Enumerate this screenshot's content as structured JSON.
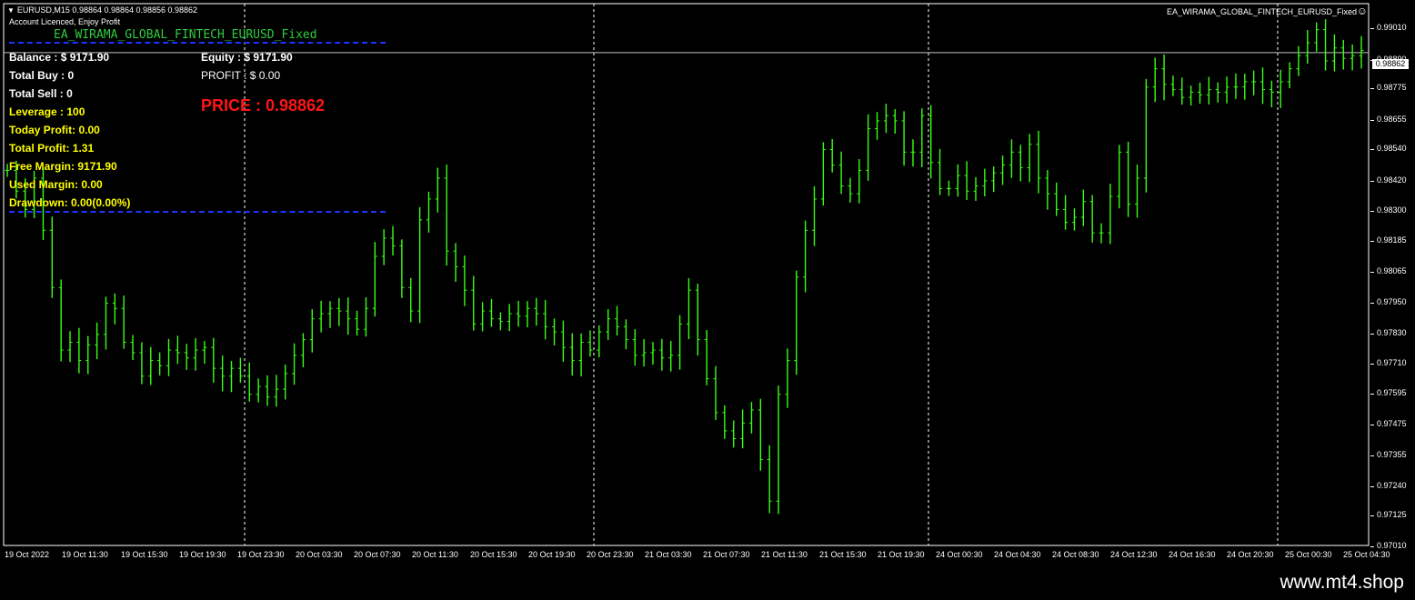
{
  "window": {
    "symbol_line": "EURUSD,M15  0.98864 0.98864 0.98856 0.98862",
    "licence_text": "Account Licenced, Enjoy Profit",
    "ea_name_top": "EA_WIRAMA_GLOBAL_FINTECH_EURUSD_Fixed",
    "smiley": "☺",
    "triangle": "▼"
  },
  "panel": {
    "ea_title": "EA_WIRAMA_GLOBAL_FINTECH_EURUSD_Fixed",
    "balance": "Balance : $ 9171.90",
    "equity": "Equity : $ 9171.90",
    "total_buy": "Total Buy  : 0",
    "total_sell": "Total Sell  : 0",
    "profit": "PROFIT  : $ 0.00",
    "price": "PRICE : 0.98862",
    "leverage": "Leverage : 100",
    "today_profit": "Today Profit: 0.00",
    "total_profit": "Total Profit: 1.31",
    "free_margin": "Free Margin: 9171.90",
    "used_margin": "Used Margin: 0.00",
    "drawdown": "Drawdown: 0.00(0.00%)"
  },
  "watermark": "www.mt4.shop",
  "colors": {
    "background": "#000000",
    "candle": "#39ff14",
    "price_text": "#ff1414",
    "info_yellow": "#ffff00",
    "dash_blue": "#1a35ff",
    "title_green": "#2ecc40"
  },
  "chart_data": {
    "type": "line",
    "symbol": "EURUSD",
    "timeframe": "M15",
    "current_price": "0.98862",
    "y_ticks": [
      "0.99010",
      "0.98890",
      "0.98775",
      "0.98655",
      "0.98540",
      "0.98420",
      "0.98300",
      "0.98185",
      "0.98065",
      "0.97950",
      "0.97830",
      "0.97710",
      "0.97595",
      "0.97475",
      "0.97355",
      "0.97240",
      "0.97125",
      "0.97010"
    ],
    "x_ticks": [
      "19 Oct 2022",
      "19 Oct 11:30",
      "19 Oct 15:30",
      "19 Oct 19:30",
      "19 Oct 23:30",
      "20 Oct 03:30",
      "20 Oct 07:30",
      "20 Oct 11:30",
      "20 Oct 15:30",
      "20 Oct 19:30",
      "20 Oct 23:30",
      "21 Oct 03:30",
      "21 Oct 07:30",
      "21 Oct 11:30",
      "21 Oct 15:30",
      "21 Oct 19:30",
      "24 Oct 00:30",
      "24 Oct 04:30",
      "24 Oct 08:30",
      "24 Oct 12:30",
      "24 Oct 16:30",
      "24 Oct 20:30",
      "25 Oct 00:30",
      "25 Oct 04:30"
    ],
    "ylim": [
      0.9697,
      0.9905
    ],
    "series": [
      {
        "values": [
          0.9841,
          0.9833,
          0.9826,
          0.9838,
          0.9818,
          0.9796,
          0.9772,
          0.9775,
          0.9768,
          0.9774,
          0.9778,
          0.979,
          0.9788,
          0.9775,
          0.9771,
          0.9762,
          0.9768,
          0.9766,
          0.9772,
          0.9771,
          0.9769,
          0.9772,
          0.9773,
          0.9765,
          0.9762,
          0.9765,
          0.9762,
          0.9755,
          0.9758,
          0.9754,
          0.9757,
          0.9763,
          0.977,
          0.9776,
          0.9784,
          0.9786,
          0.9788,
          0.9787,
          0.9784,
          0.978,
          0.9788,
          0.9808,
          0.9815,
          0.9812,
          0.9796,
          0.9787,
          0.9822,
          0.983,
          0.9838,
          0.981,
          0.9804,
          0.9795,
          0.9782,
          0.9787,
          0.9784,
          0.9783,
          0.9786,
          0.9785,
          0.9788,
          0.9786,
          0.9781,
          0.9779,
          0.9773,
          0.9768,
          0.9775,
          0.9772,
          0.9779,
          0.9784,
          0.9781,
          0.9776,
          0.977,
          0.9771,
          0.9772,
          0.9769,
          0.977,
          0.9782,
          0.9795,
          0.9776,
          0.9761,
          0.9748,
          0.9741,
          0.9738,
          0.9744,
          0.9749,
          0.973,
          0.9714,
          0.9755,
          0.9768,
          0.98,
          0.9818,
          0.983,
          0.9849,
          0.9843,
          0.9835,
          0.9832,
          0.9841,
          0.9857,
          0.986,
          0.9862,
          0.986,
          0.9848,
          0.9848,
          0.9862,
          0.9844,
          0.9834,
          0.9834,
          0.9839,
          0.9833,
          0.9835,
          0.9837,
          0.984,
          0.9843,
          0.9848,
          0.9842,
          0.9851,
          0.9838,
          0.9832,
          0.9826,
          0.9821,
          0.9823,
          0.9829,
          0.9817,
          0.9817,
          0.9831,
          0.9848,
          0.9828,
          0.9838,
          0.9873,
          0.988,
          0.9874,
          0.9872,
          0.9869,
          0.9871,
          0.987,
          0.9872,
          0.9871,
          0.9873,
          0.9873,
          0.9875,
          0.9875,
          0.9872,
          0.9871,
          0.9875,
          0.988,
          0.9885,
          0.989,
          0.9895,
          0.9883,
          0.9888,
          0.9884,
          0.9885,
          0.9887
        ]
      }
    ]
  }
}
